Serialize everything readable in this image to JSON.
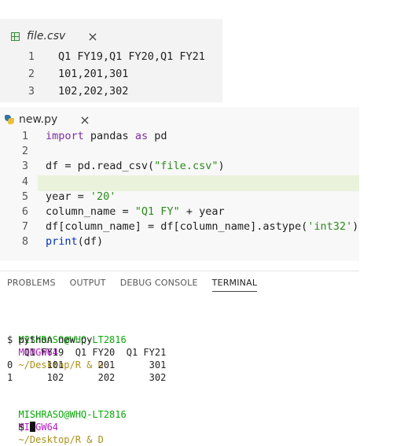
{
  "csv_editor": {
    "tab_title": "file.csv",
    "close_glyph": "×",
    "icon": "spreadsheet-icon",
    "lines": [
      {
        "num": "1",
        "text": "Q1 FY19,Q1 FY20,Q1 FY21"
      },
      {
        "num": "2",
        "text": "101,201,301"
      },
      {
        "num": "3",
        "text": "102,202,302"
      }
    ]
  },
  "py_editor": {
    "tab_title": "new.py",
    "close_glyph": "×",
    "icon": "python-icon",
    "highlighted_line": "4",
    "lines": [
      {
        "num": "1",
        "parts": [
          {
            "t": "import",
            "c": "kw"
          },
          {
            "t": " pandas ",
            "c": ""
          },
          {
            "t": "as",
            "c": "kw"
          },
          {
            "t": " pd",
            "c": ""
          }
        ]
      },
      {
        "num": "2",
        "parts": []
      },
      {
        "num": "3",
        "parts": [
          {
            "t": "df = pd.read_csv(",
            "c": ""
          },
          {
            "t": "\"file.csv\"",
            "c": "str"
          },
          {
            "t": ")",
            "c": ""
          }
        ]
      },
      {
        "num": "4",
        "parts": []
      },
      {
        "num": "5",
        "parts": [
          {
            "t": "year = ",
            "c": ""
          },
          {
            "t": "'20'",
            "c": "str"
          }
        ]
      },
      {
        "num": "6",
        "parts": [
          {
            "t": "column_name = ",
            "c": ""
          },
          {
            "t": "\"Q1 FY\"",
            "c": "str"
          },
          {
            "t": " + year",
            "c": ""
          }
        ]
      },
      {
        "num": "7",
        "parts": [
          {
            "t": "df[column_name] = df[column_name].astype(",
            "c": ""
          },
          {
            "t": "'int32'",
            "c": "str"
          },
          {
            "t": ")",
            "c": ""
          }
        ]
      },
      {
        "num": "8",
        "parts": [
          {
            "t": "print",
            "c": "kw2"
          },
          {
            "t": "(df)",
            "c": ""
          }
        ]
      }
    ]
  },
  "panel": {
    "tabs": [
      "PROBLEMS",
      "OUTPUT",
      "DEBUG CONSOLE",
      "TERMINAL"
    ],
    "active_tab": "TERMINAL"
  },
  "terminal": {
    "prompt1": {
      "user": "MISHRASO@WHQ-LT2816",
      "shell": "MINGW64",
      "path": "~/Desktop/R & D"
    },
    "command": "$ python new.py",
    "output": [
      "   Q1 FY19  Q1 FY20  Q1 FY21",
      "0      101      201      301",
      "1      102      202      302"
    ],
    "prompt2": {
      "user": "MISHRASO@WHQ-LT2816",
      "shell": "MINGW64",
      "path": "~/Desktop/R & D"
    },
    "input_prefix": "$ "
  }
}
